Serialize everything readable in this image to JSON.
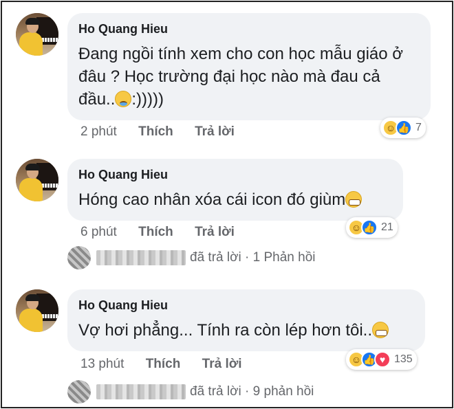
{
  "comments": [
    {
      "author": "Ho Quang Hieu",
      "text": "Đang ngồi  tính xem cho con học mẫu giáo ở đâu ? Học trường đại học nào mà đau cả đầu..",
      "suffix": ":)))))",
      "emoji": "sad-sweat-emoji-icon",
      "time": "2 phút",
      "like_label": "Thích",
      "reply_label": "Trả lời",
      "reaction_count": "7"
    },
    {
      "author": "Ho Quang Hieu",
      "text": "Hóng cao nhân xóa cái icon đó giùm",
      "emoji": "grinning-sweat-emoji-icon",
      "time": "6 phút",
      "like_label": "Thích",
      "reply_label": "Trả lời",
      "reaction_count": "21",
      "replies": {
        "text": "đã trả lời · 1 Phản hồi"
      }
    },
    {
      "author": "Ho Quang Hieu",
      "text": "Vợ hơi phẳng... Tính ra còn lép hơn tôi..",
      "emoji": "grimacing-emoji-icon",
      "time": "13 phút",
      "like_label": "Thích",
      "reply_label": "Trả lời",
      "reaction_count": "135",
      "replies": {
        "text": "đã trả lời · 9 phản hồi"
      }
    }
  ],
  "colors": {
    "bubble": "#f0f2f5",
    "meta_text": "#65676b",
    "like_blue": "#1877f2",
    "love_red": "#f33e58",
    "haha_yellow": "#f7c844"
  }
}
